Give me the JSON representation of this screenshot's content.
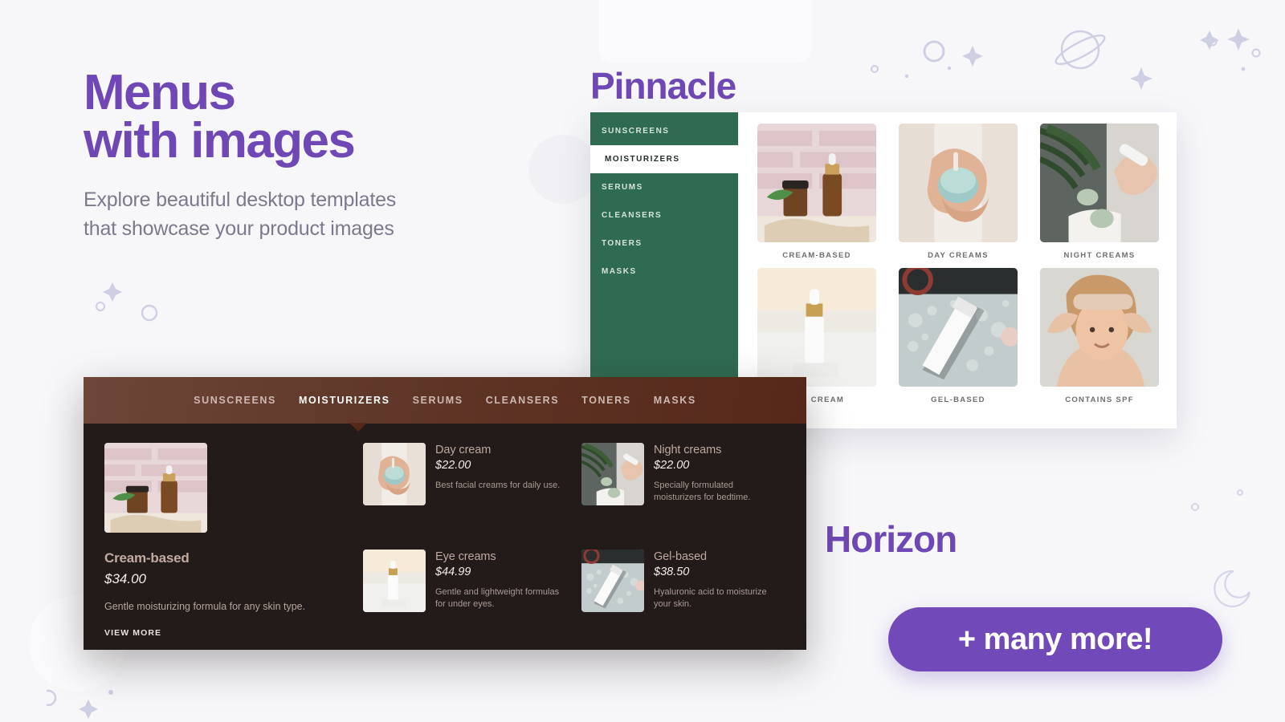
{
  "hero": {
    "title_line1": "Menus",
    "title_line2": "with images",
    "subtitle_line1": "Explore beautiful desktop templates",
    "subtitle_line2": "that showcase your product images"
  },
  "captions": {
    "pinnacle": "Pinnacle",
    "horizon": "Horizon"
  },
  "colors": {
    "brand_purple": "#7048b6",
    "cta_purple": "#7149b8",
    "sidebar_green": "#2f6b51",
    "menu_dark": "#221b19",
    "nav_brown_start": "#6d4639",
    "nav_brown_end": "#56281a",
    "page_background": "#f7f7fa"
  },
  "pinnacle": {
    "sidebar": [
      {
        "label": "SUNSCREENS",
        "active": false
      },
      {
        "label": "MOISTURIZERS",
        "active": true
      },
      {
        "label": "SERUMS",
        "active": false
      },
      {
        "label": "CLEANSERS",
        "active": false
      },
      {
        "label": "TONERS",
        "active": false
      },
      {
        "label": "MASKS",
        "active": false
      }
    ],
    "grid": [
      {
        "label": "CREAM-BASED",
        "image": "amber-bottles-on-brick-wall"
      },
      {
        "label": "DAY CREAMS",
        "image": "hands-holding-open-cream-jar"
      },
      {
        "label": "NIGHT CREAMS",
        "image": "jade-roller-with-palm-leaf"
      },
      {
        "label": "EYE CREAM",
        "image": "white-serum-bottle-gold-cap"
      },
      {
        "label": "GEL-BASED",
        "image": "white-tube-on-wet-surface"
      },
      {
        "label": "CONTAINS SPF",
        "image": "woman-with-headband-smiling"
      }
    ]
  },
  "mega_menu": {
    "nav": [
      {
        "label": "SUNSCREENS",
        "active": false
      },
      {
        "label": "MOISTURIZERS",
        "active": true
      },
      {
        "label": "SERUMS",
        "active": false
      },
      {
        "label": "CLEANSERS",
        "active": false
      },
      {
        "label": "TONERS",
        "active": false
      },
      {
        "label": "MASKS",
        "active": false
      }
    ],
    "feature": {
      "name": "Cream-based",
      "price": "$34.00",
      "description": "Gentle moisturizing formula for any skin type.",
      "view_more": "VIEW MORE",
      "image": "amber-bottles-on-brick-wall"
    },
    "items": [
      {
        "name": "Day cream",
        "price": "$22.00",
        "description": "Best facial creams for daily use.",
        "image": "hands-holding-open-cream-jar"
      },
      {
        "name": "Night creams",
        "price": "$22.00",
        "description": "Specially formulated moisturizers for bedtime.",
        "image": "jade-roller-with-palm-leaf"
      },
      {
        "name": "Eye creams",
        "price": "$44.99",
        "description": "Gentle and lightweight formulas for under eyes.",
        "image": "white-serum-bottle-gold-cap"
      },
      {
        "name": "Gel-based",
        "price": "$38.50",
        "description": "Hyaluronic acid to moisturize your skin.",
        "image": "white-tube-on-wet-surface"
      }
    ]
  },
  "cta": {
    "label": "+ many more!"
  },
  "decorations": {
    "items": [
      "planet-icon",
      "sparkle-icon",
      "circle-outline-icon",
      "dot-icon"
    ]
  }
}
